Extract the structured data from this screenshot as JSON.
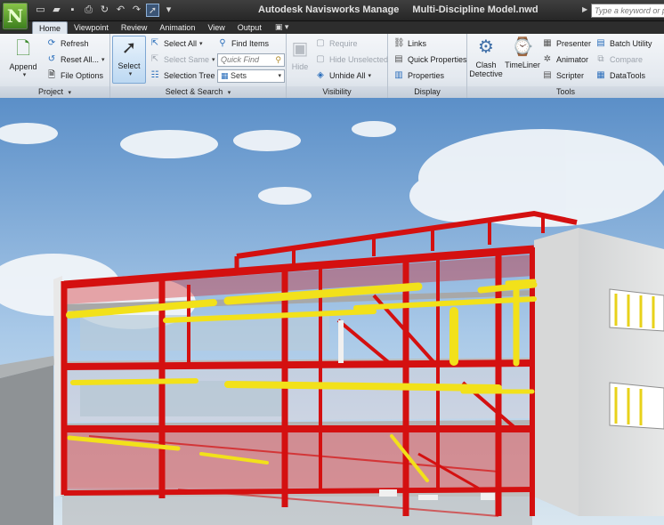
{
  "app": {
    "logo_letter": "N",
    "title": "Autodesk Navisworks Manage",
    "file": "Multi-Discipline Model.nwd",
    "search_placeholder": "Type a keyword or phrase"
  },
  "tabs": [
    "Home",
    "Viewpoint",
    "Review",
    "Animation",
    "View",
    "Output"
  ],
  "ribbon": {
    "project": {
      "title": "Project",
      "append": "Append",
      "refresh": "Refresh",
      "reset_all": "Reset All...",
      "file_options": "File Options"
    },
    "select_search": {
      "title": "Select & Search",
      "select": "Select",
      "select_all": "Select All",
      "select_same": "Select Same",
      "selection_tree": "Selection Tree",
      "find_items": "Find Items",
      "quick_find_placeholder": "Quick Find",
      "sets": "Sets"
    },
    "visibility": {
      "title": "Visibility",
      "hide": "Hide",
      "require": "Require",
      "hide_unselected": "Hide Unselected",
      "unhide_all": "Unhide All"
    },
    "display": {
      "title": "Display",
      "links": "Links",
      "quick_properties": "Quick Properties",
      "properties": "Properties"
    },
    "tools": {
      "title": "Tools",
      "clash_detective_1": "Clash",
      "clash_detective_2": "Detective",
      "timeliner": "TimeLiner",
      "presenter": "Presenter",
      "animator": "Animator",
      "scripter": "Scripter",
      "batch_utility": "Batch Utility",
      "compare": "Compare",
      "datatools": "DataTools"
    }
  },
  "colors": {
    "steel": "#d41010",
    "duct": "#f2e11a",
    "sky": "#7aa7d8"
  }
}
